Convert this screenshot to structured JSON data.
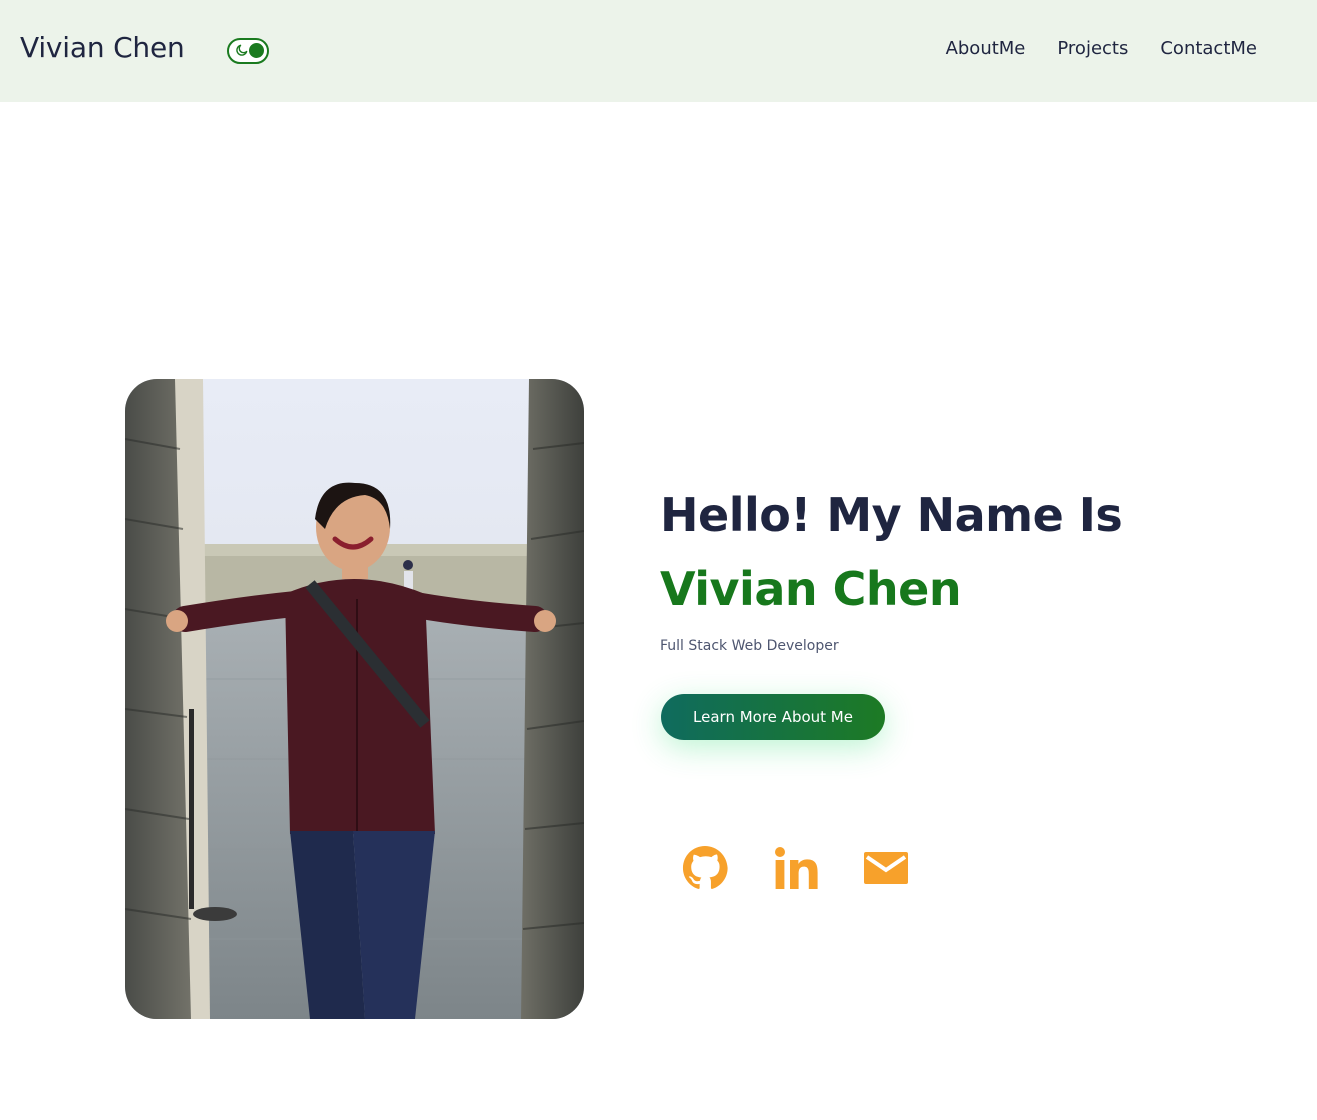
{
  "header": {
    "brand": "Vivian Chen",
    "nav": [
      {
        "label": "AboutMe"
      },
      {
        "label": "Projects"
      },
      {
        "label": "ContactMe"
      }
    ],
    "theme_toggle": {
      "state": "dark-mode-enabled",
      "icon": "moon-icon"
    }
  },
  "hero": {
    "greeting": "Hello! My Name Is",
    "name": "Vivian Chen",
    "subtitle": "Full Stack Web Developer",
    "cta_label": "Learn More About Me",
    "photo": "portrait-photo"
  },
  "socials": [
    {
      "icon": "github-icon",
      "label": "GitHub"
    },
    {
      "icon": "linkedin-icon",
      "label": "LinkedIn"
    },
    {
      "icon": "mail-icon",
      "label": "Email"
    }
  ],
  "colors": {
    "header_bg": "#ecf3ea",
    "text_dark": "#1f2540",
    "accent_green": "#17781c",
    "cta_gradient_start": "#0f6b5e",
    "cta_gradient_end": "#1d7a24",
    "social_orange": "#f7a12b"
  }
}
